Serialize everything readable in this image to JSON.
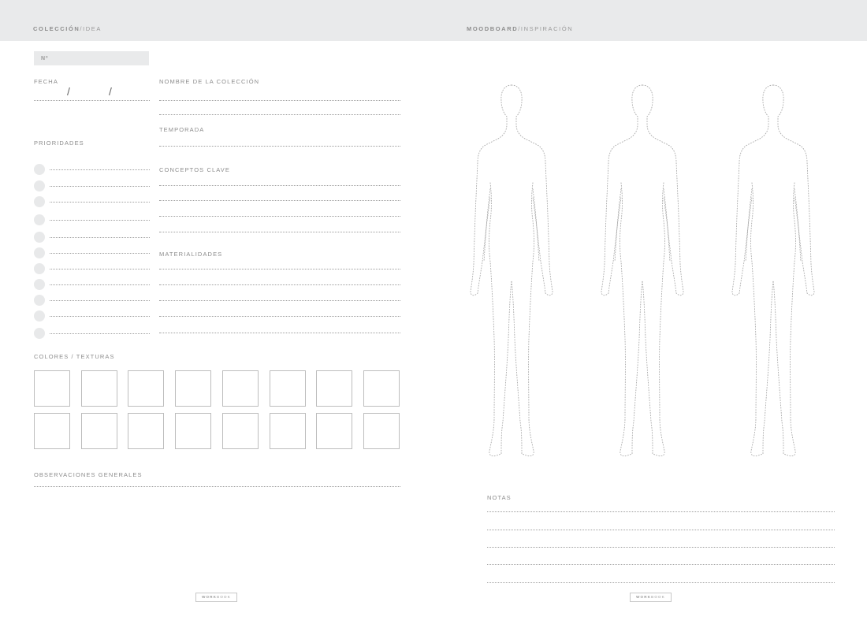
{
  "left_page": {
    "header": {
      "title_bold": "COLECCIÓN",
      "title_rest": "/IDEA"
    },
    "number_label": "Nº",
    "fecha_label": "FECHA",
    "date_separator": "/",
    "coleccion_label": "NOMBRE DE LA COLECCIÓN",
    "temporada_label": "TEMPORADA",
    "prioridades_label": "PRIORIDADES",
    "conceptos_label": "CONCEPTOS CLAVE",
    "materialidades_label": "MATERIALIDADES",
    "colores_label": "COLORES / TEXTURAS",
    "observaciones_label": "OBSERVACIONES GENERALES",
    "footer": {
      "bold": "WORK",
      "rest": "BOOK"
    }
  },
  "right_page": {
    "header": {
      "title_bold": "MOODBOARD",
      "title_rest": "/INSPIRACIÓN"
    },
    "notas_label": "NOTAS",
    "footer": {
      "bold": "WORK",
      "rest": "BOOK"
    }
  },
  "colors": {
    "header_bg": "#e9eaeb",
    "circle_fill": "#e8e9ea",
    "line": "#9e9e9e",
    "text": "#8c8c8c"
  },
  "icons": [
    "croquis-figure-outline"
  ]
}
